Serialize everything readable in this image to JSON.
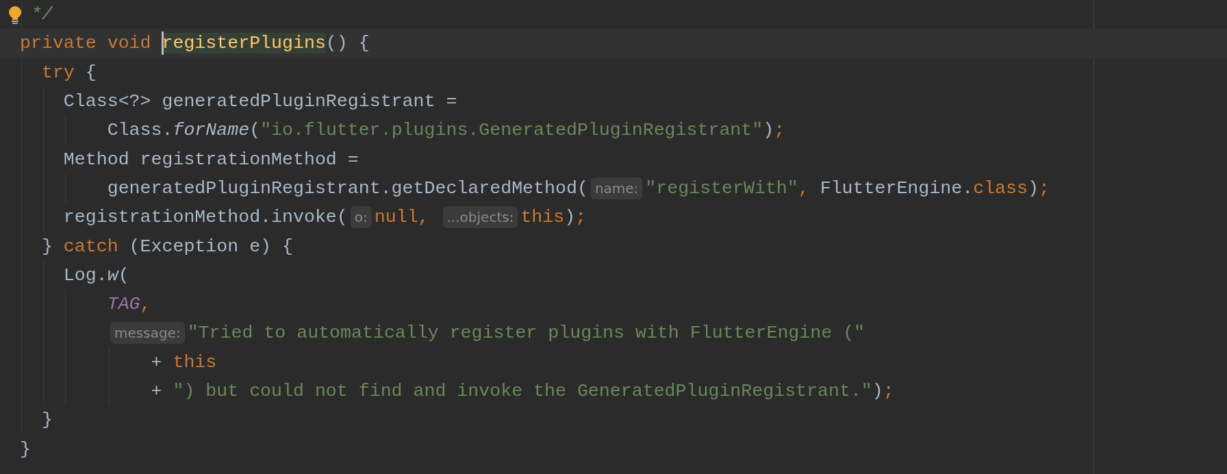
{
  "lines": [
    {
      "bulb": true,
      "current": false,
      "caret": false,
      "parts": [
        {
          "kind": "code",
          "tokens": [
            {
              "text": " */",
              "kind": "comment"
            }
          ]
        }
      ]
    },
    {
      "bulb": false,
      "current": true,
      "caret": true,
      "parts": [
        {
          "kind": "code",
          "tokens": [
            {
              "text": "private void ",
              "kind": "keyword"
            },
            {
              "text": "registerPlugins",
              "kind": "declaration"
            },
            {
              "text": "() {",
              "kind": "plain"
            }
          ]
        }
      ]
    },
    {
      "bulb": false,
      "current": false,
      "caret": false,
      "parts": [
        {
          "kind": "code",
          "tokens": [
            {
              "text": "  try",
              "kind": "keyword"
            },
            {
              "text": " {",
              "kind": "plain"
            }
          ]
        }
      ]
    },
    {
      "bulb": false,
      "current": false,
      "caret": false,
      "parts": [
        {
          "kind": "code",
          "tokens": [
            {
              "text": "    Class<?> generatedPluginRegistrant =",
              "kind": "plain"
            }
          ]
        }
      ]
    },
    {
      "bulb": false,
      "current": false,
      "caret": false,
      "parts": [
        {
          "kind": "code",
          "tokens": [
            {
              "text": "        Class.",
              "kind": "plain"
            },
            {
              "text": "forName",
              "kind": "italic"
            },
            {
              "text": "(",
              "kind": "plain"
            },
            {
              "text": "\"io.flutter.plugins.GeneratedPluginRegistrant\"",
              "kind": "string"
            },
            {
              "text": ")",
              "kind": "plain"
            },
            {
              "text": ";",
              "kind": "keyword"
            }
          ]
        }
      ]
    },
    {
      "bulb": false,
      "current": false,
      "caret": false,
      "parts": [
        {
          "kind": "code",
          "tokens": [
            {
              "text": "    Method registrationMethod =",
              "kind": "plain"
            }
          ]
        }
      ]
    },
    {
      "bulb": false,
      "current": false,
      "caret": false,
      "parts": [
        {
          "kind": "code",
          "tokens": [
            {
              "text": "        generatedPluginRegistrant.getDeclaredMethod(",
              "kind": "plain"
            }
          ]
        },
        {
          "kind": "hint",
          "text": "name:"
        },
        {
          "kind": "code",
          "tokens": [
            {
              "text": "\"registerWith\"",
              "kind": "string"
            },
            {
              "text": ", ",
              "kind": "keyword"
            },
            {
              "text": "FlutterEngine.",
              "kind": "plain"
            },
            {
              "text": "class",
              "kind": "keyword"
            },
            {
              "text": ")",
              "kind": "plain"
            },
            {
              "text": ";",
              "kind": "keyword"
            }
          ]
        }
      ]
    },
    {
      "bulb": false,
      "current": false,
      "caret": false,
      "parts": [
        {
          "kind": "code",
          "tokens": [
            {
              "text": "    registrationMethod.invoke(",
              "kind": "plain"
            }
          ]
        },
        {
          "kind": "hint",
          "text": "o:"
        },
        {
          "kind": "code",
          "tokens": [
            {
              "text": "null, ",
              "kind": "keyword"
            }
          ]
        },
        {
          "kind": "hint",
          "text": "...objects:"
        },
        {
          "kind": "code",
          "tokens": [
            {
              "text": "this",
              "kind": "keyword"
            },
            {
              "text": ")",
              "kind": "plain"
            },
            {
              "text": ";",
              "kind": "keyword"
            }
          ]
        }
      ]
    },
    {
      "bulb": false,
      "current": false,
      "caret": false,
      "parts": [
        {
          "kind": "code",
          "tokens": [
            {
              "text": "  } ",
              "kind": "plain"
            },
            {
              "text": "catch",
              "kind": "keyword"
            },
            {
              "text": " (Exception e) {",
              "kind": "plain"
            }
          ]
        }
      ]
    },
    {
      "bulb": false,
      "current": false,
      "caret": false,
      "parts": [
        {
          "kind": "code",
          "tokens": [
            {
              "text": "    Log.",
              "kind": "plain"
            },
            {
              "text": "w",
              "kind": "italic"
            },
            {
              "text": "(",
              "kind": "plain"
            }
          ]
        }
      ]
    },
    {
      "bulb": false,
      "current": false,
      "caret": false,
      "parts": [
        {
          "kind": "code",
          "tokens": [
            {
              "text": "        TAG",
              "kind": "constant"
            },
            {
              "text": ",",
              "kind": "keyword"
            }
          ]
        }
      ]
    },
    {
      "bulb": false,
      "current": false,
      "caret": false,
      "parts": [
        {
          "kind": "hint",
          "text": "message:"
        },
        {
          "kind": "code",
          "tokens": [
            {
              "text": "\"Tried to automatically register plugins with FlutterEngine (\"",
              "kind": "string"
            }
          ]
        }
      ]
    },
    {
      "bulb": false,
      "current": false,
      "caret": false,
      "parts": [
        {
          "kind": "code",
          "tokens": [
            {
              "text": "            + ",
              "kind": "plain"
            },
            {
              "text": "this",
              "kind": "keyword"
            }
          ]
        }
      ]
    },
    {
      "bulb": false,
      "current": false,
      "caret": false,
      "parts": [
        {
          "kind": "code",
          "tokens": [
            {
              "text": "            + ",
              "kind": "plain"
            },
            {
              "text": "\") but could not find and invoke the GeneratedPluginRegistrant.\"",
              "kind": "string"
            },
            {
              "text": ")",
              "kind": "plain"
            },
            {
              "text": ";",
              "kind": "keyword"
            }
          ]
        }
      ]
    },
    {
      "bulb": false,
      "current": false,
      "caret": false,
      "parts": [
        {
          "kind": "code",
          "tokens": [
            {
              "text": "  }",
              "kind": "plain"
            }
          ]
        }
      ]
    },
    {
      "bulb": false,
      "current": false,
      "caret": false,
      "parts": [
        {
          "kind": "code",
          "tokens": [
            {
              "text": "}",
              "kind": "plain"
            }
          ]
        }
      ]
    }
  ]
}
